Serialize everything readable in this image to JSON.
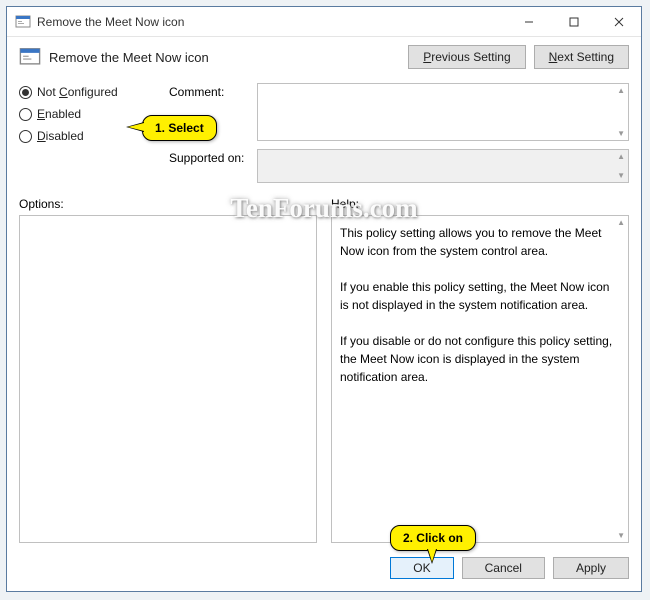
{
  "window": {
    "title": "Remove the Meet Now icon"
  },
  "header": {
    "heading": "Remove the Meet Now icon",
    "prev_btn": "Previous Setting",
    "next_btn": "Next Setting"
  },
  "radios": {
    "not_configured": {
      "pre": "Not ",
      "key": "C",
      "post": "onfigured",
      "checked": true
    },
    "enabled": {
      "key": "E",
      "post": "nabled",
      "checked": false
    },
    "disabled": {
      "key": "D",
      "post": "isabled",
      "checked": false
    }
  },
  "fields": {
    "comment_label": "Comment:",
    "comment_value": "",
    "supported_label": "Supported on:",
    "supported_value": ""
  },
  "panels": {
    "options_label": "Options:",
    "help_label": "Help:",
    "help_text": "This policy setting allows you to remove the Meet Now icon from the system control area.\n\nIf you enable this policy setting, the Meet Now icon is not displayed in the system notification area.\n\nIf you disable or do not configure this policy setting, the Meet Now icon is displayed in the system notification area."
  },
  "buttons": {
    "ok": "OK",
    "cancel": "Cancel",
    "apply": "Apply"
  },
  "annotations": {
    "select": "1. Select",
    "click": "2. Click on"
  },
  "watermark": "TenForums.com"
}
